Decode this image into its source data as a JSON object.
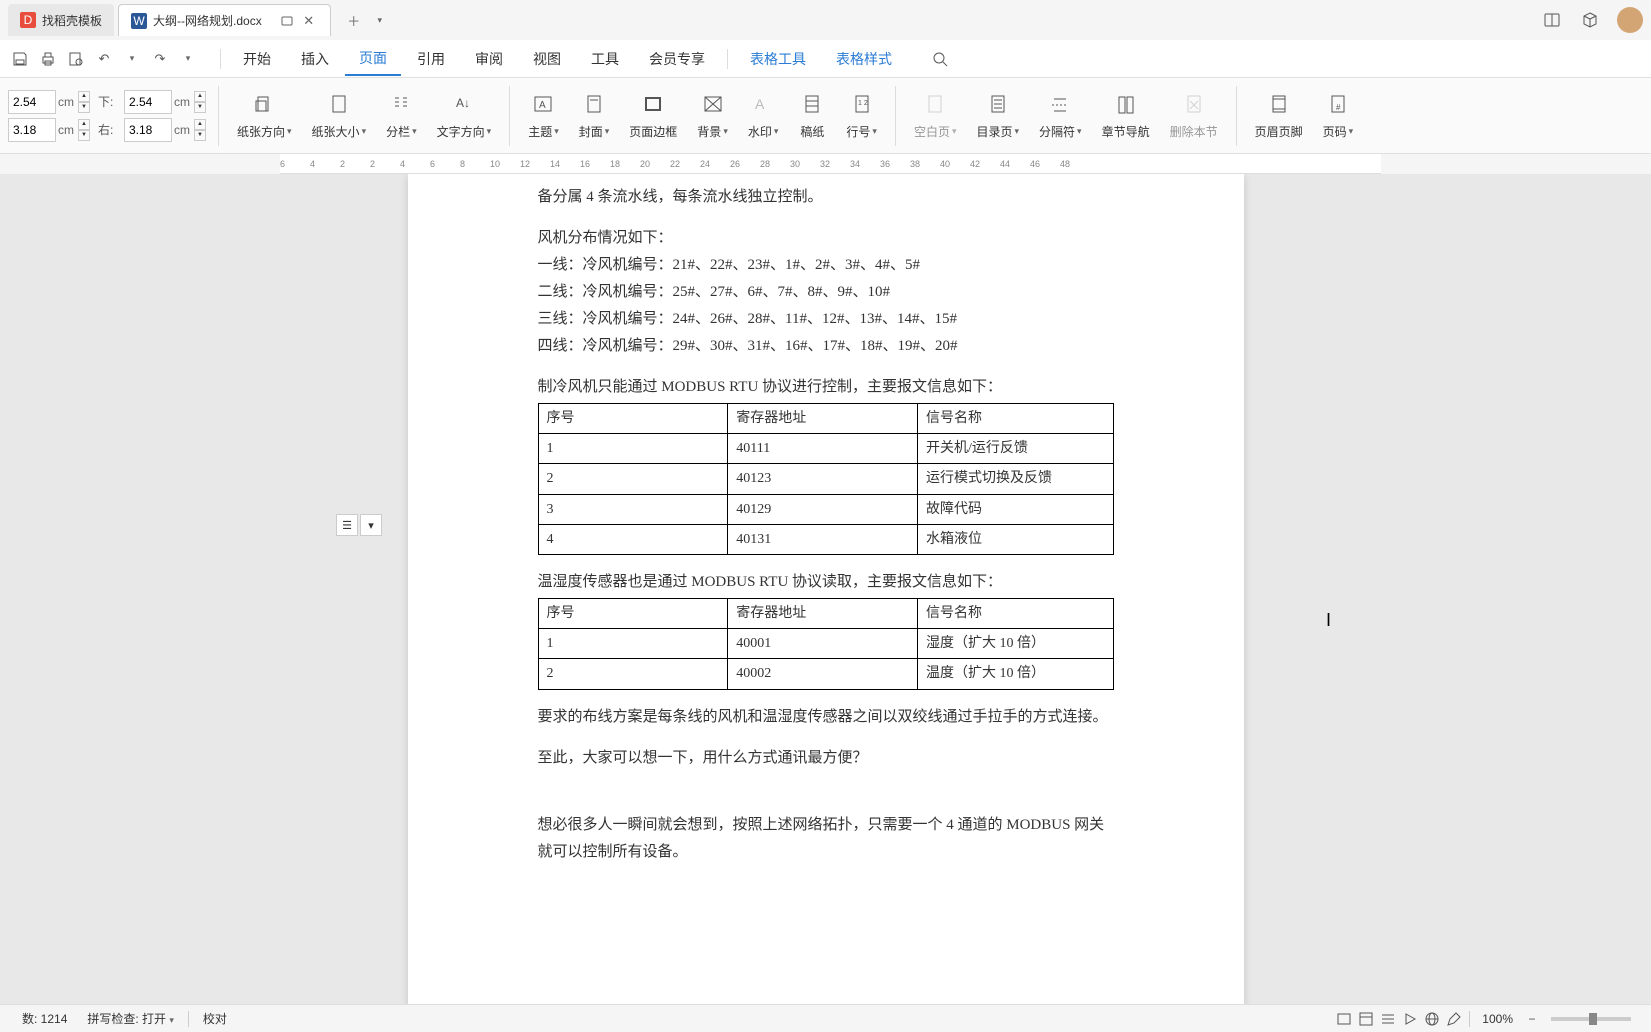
{
  "titlebar": {
    "tab1_label": "找稻壳模板",
    "tab2_label": "大纲--网络规划.docx"
  },
  "menu": {
    "start": "开始",
    "insert": "插入",
    "page": "页面",
    "reference": "引用",
    "review": "审阅",
    "view": "视图",
    "tools": "工具",
    "member": "会员专享",
    "table_tools": "表格工具",
    "table_style": "表格样式"
  },
  "ribbon": {
    "margin_top": "2.54",
    "margin_bottom_label": "下:",
    "margin_bottom": "2.54",
    "margin_left": "3.18",
    "margin_right_label": "右:",
    "margin_right": "3.18",
    "unit": "cm",
    "paper_dir": "纸张方向",
    "paper_size": "纸张大小",
    "column": "分栏",
    "text_dir": "文字方向",
    "theme": "主题",
    "cover": "封面",
    "border": "页面边框",
    "background": "背景",
    "watermark": "水印",
    "grid": "稿纸",
    "line_no": "行号",
    "blank_page": "空白页",
    "toc": "目录页",
    "separator": "分隔符",
    "chapter_nav": "章节导航",
    "delete_section": "删除本节",
    "header_footer": "页眉页脚",
    "page_no": "页码"
  },
  "ruler": {
    "marks": [
      "6",
      "4",
      "2",
      "2",
      "4",
      "6",
      "8",
      "10",
      "12",
      "14",
      "16",
      "18",
      "20",
      "22",
      "24",
      "26",
      "28",
      "30",
      "32",
      "34",
      "36",
      "38",
      "40",
      "42",
      "44",
      "46",
      "48"
    ]
  },
  "document": {
    "intro": "备分属 4 条流水线，每条流水线独立控制。",
    "fan_header": "风机分布情况如下：",
    "line1": "一线：冷风机编号：21#、22#、23#、1#、2#、3#、4#、5#",
    "line2": "二线：冷风机编号：25#、27#、6#、7#、8#、9#、10#",
    "line3": "三线：冷风机编号：24#、26#、28#、11#、12#、13#、14#、15#",
    "line4": "四线：冷风机编号：29#、30#、31#、16#、17#、18#、19#、20#",
    "modbus_intro": "制冷风机只能通过 MODBUS RTU 协议进行控制，主要报文信息如下：",
    "table1": {
      "h1": "序号",
      "h2": "寄存器地址",
      "h3": "信号名称",
      "r1c1": "1",
      "r1c2": "40111",
      "r1c3": "开关机/运行反馈",
      "r2c1": "2",
      "r2c2": "40123",
      "r2c3": "运行模式切换及反馈",
      "r3c1": "3",
      "r3c2": "40129",
      "r3c3": "故障代码",
      "r4c1": "4",
      "r4c2": "40131",
      "r4c3": "水箱液位"
    },
    "sensor_intro": "温湿度传感器也是通过 MODBUS RTU 协议读取，主要报文信息如下：",
    "table2": {
      "h1": "序号",
      "h2": "寄存器地址",
      "h3": "信号名称",
      "r1c1": "1",
      "r1c2": "40001",
      "r1c3": "湿度（扩大 10 倍）",
      "r2c1": "2",
      "r2c2": "40002",
      "r2c3": "温度（扩大 10 倍）"
    },
    "wiring": "要求的布线方案是每条线的风机和温湿度传感器之间以双绞线通过手拉手的方式连接。",
    "question": "至此，大家可以想一下，用什么方式通讯最方便？",
    "answer": "想必很多人一瞬间就会想到，按照上述网络拓扑，只需要一个 4 通道的 MODBUS 网关就可以控制所有设备。"
  },
  "status": {
    "word_count": "数: 1214",
    "spell_check": "拼写检查: 打开",
    "proof": "校对",
    "zoom": "100%"
  }
}
